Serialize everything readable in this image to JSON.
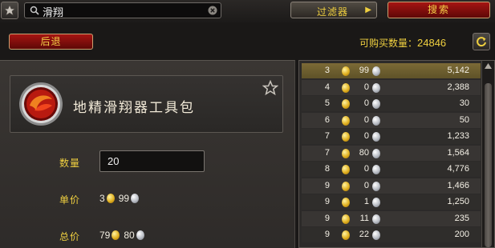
{
  "search": {
    "value": "滑翔"
  },
  "toolbar": {
    "filter_label": "过滤器",
    "search_label": "搜索"
  },
  "back_label": "后退",
  "buyable": {
    "label": "可购买数量：",
    "count": "24846"
  },
  "item": {
    "name": "地精滑翔器工具包"
  },
  "fields": {
    "qty_label": "数量",
    "qty_value": "20",
    "unit_label": "单价",
    "unit_gold": "3",
    "unit_silver": "99",
    "total_label": "总价",
    "total_gold": "79",
    "total_silver": "80"
  },
  "listings": [
    {
      "gold": "3",
      "silver": "99",
      "qty": "5,142"
    },
    {
      "gold": "4",
      "silver": "0",
      "qty": "2,388"
    },
    {
      "gold": "5",
      "silver": "0",
      "qty": "30"
    },
    {
      "gold": "6",
      "silver": "0",
      "qty": "50"
    },
    {
      "gold": "7",
      "silver": "0",
      "qty": "1,233"
    },
    {
      "gold": "7",
      "silver": "80",
      "qty": "1,564"
    },
    {
      "gold": "8",
      "silver": "0",
      "qty": "4,776"
    },
    {
      "gold": "9",
      "silver": "0",
      "qty": "1,466"
    },
    {
      "gold": "9",
      "silver": "1",
      "qty": "1,250"
    },
    {
      "gold": "9",
      "silver": "11",
      "qty": "235"
    },
    {
      "gold": "9",
      "silver": "22",
      "qty": "200"
    }
  ],
  "colors": {
    "accent": "#f0d040",
    "button_red": "#a61512",
    "selected_row": "#7c6a36"
  },
  "icons": [
    "star-icon",
    "search-icon",
    "clear-icon",
    "arrow-right-icon",
    "refresh-icon",
    "item-icon",
    "gold-coin-icon",
    "silver-coin-icon",
    "scroll-up-icon"
  ]
}
